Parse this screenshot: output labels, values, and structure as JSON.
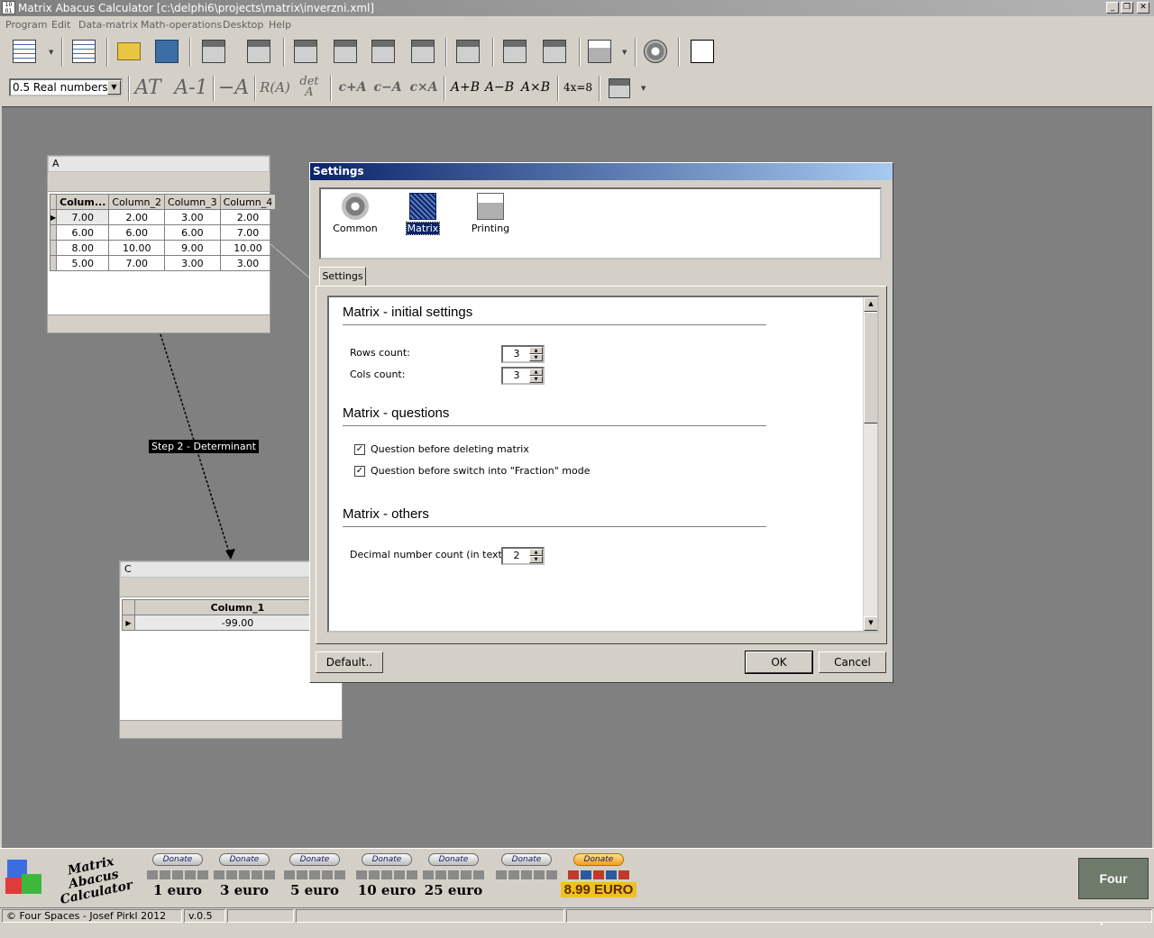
{
  "window": {
    "title": "Matrix Abacus Calculator [c:\\delphi6\\projects\\matrix\\inverzni.xml]"
  },
  "menu": [
    "Program",
    "Edit",
    "Data-matrix",
    "Math-operations",
    "Desktop",
    "Help"
  ],
  "toolbar": {
    "number_mode": "0.5 Real numbers",
    "math_ops": {
      "transpose": "AT",
      "inverse": "A-1",
      "negate": "−A",
      "rank": "R(A)",
      "det_top": "det",
      "det_bottom": "A",
      "c_plus_a": "c+A",
      "c_minus_a": "c−A",
      "c_times_a": "c×A",
      "a_plus_b": "A+B",
      "a_minus_b": "A−B",
      "a_times_b": "A×B",
      "solve": "4x=8"
    }
  },
  "matrix_a": {
    "title": "A",
    "columns": [
      "Colum...",
      "Column_2",
      "Column_3",
      "Column_4"
    ],
    "rows": [
      [
        "7.00",
        "2.00",
        "3.00",
        "2.00"
      ],
      [
        "6.00",
        "6.00",
        "6.00",
        "7.00"
      ],
      [
        "8.00",
        "10.00",
        "9.00",
        "10.00"
      ],
      [
        "5.00",
        "7.00",
        "3.00",
        "3.00"
      ]
    ]
  },
  "step_label": "Step 2 - Determinant",
  "matrix_c": {
    "title": "C",
    "columns": [
      "Column_1"
    ],
    "rows": [
      [
        "-99.00"
      ]
    ]
  },
  "settings": {
    "title": "Settings",
    "categories": [
      "Common",
      "Matrix",
      "Printing"
    ],
    "tab": "Settings",
    "sections": {
      "initial": "Matrix - initial settings",
      "questions": "Matrix - questions",
      "others": "Matrix - others"
    },
    "rows_count_label": "Rows count:",
    "rows_count": "3",
    "cols_count_label": "Cols count:",
    "cols_count": "3",
    "q_delete": "Question before deleting matrix",
    "q_fraction": "Question before switch into \"Fraction\" mode",
    "decimal_label": "Decimal number count (in text):",
    "decimal_count": "2",
    "default_btn": "Default..",
    "ok_btn": "OK",
    "cancel_btn": "Cancel"
  },
  "banner": {
    "logo_line1": "Matrix Abacus",
    "logo_line2": "Calculator",
    "donate_label": "Donate",
    "amounts": [
      "1 euro",
      "3 euro",
      "5 euro",
      "10 euro",
      "25 euro",
      "",
      "8.99 EURO"
    ],
    "brand": "Four Spaces"
  },
  "status": {
    "copyright": "© Four Spaces - Josef Pirkl 2012",
    "version": "v.0.5"
  }
}
